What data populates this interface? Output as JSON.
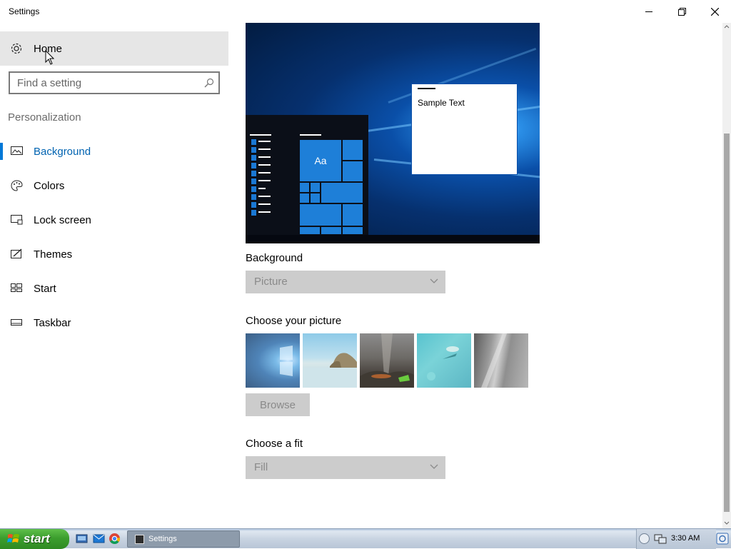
{
  "window": {
    "title": "Settings"
  },
  "sidebar": {
    "home_label": "Home",
    "search_placeholder": "Find a setting",
    "section_heading": "Personalization",
    "items": [
      {
        "label": "Background",
        "icon": "picture-icon",
        "active": true
      },
      {
        "label": "Colors",
        "icon": "palette-icon",
        "active": false
      },
      {
        "label": "Lock screen",
        "icon": "lock-screen-icon",
        "active": false
      },
      {
        "label": "Themes",
        "icon": "themes-icon",
        "active": false
      },
      {
        "label": "Start",
        "icon": "start-icon",
        "active": false
      },
      {
        "label": "Taskbar",
        "icon": "taskbar-icon",
        "active": false
      }
    ]
  },
  "main": {
    "preview": {
      "sample_text": "Sample Text",
      "tile_text": "Aa"
    },
    "background": {
      "label": "Background",
      "value": "Picture"
    },
    "picture": {
      "label": "Choose your picture",
      "browse_label": "Browse"
    },
    "fit": {
      "label": "Choose a fit",
      "value": "Fill"
    }
  },
  "os_taskbar": {
    "start_label": "start",
    "task_label": "Settings",
    "clock": "3:30 AM"
  },
  "colors": {
    "accent": "#0078d7",
    "selected_text": "#0063b1",
    "disabled_fill": "#cccccc"
  }
}
